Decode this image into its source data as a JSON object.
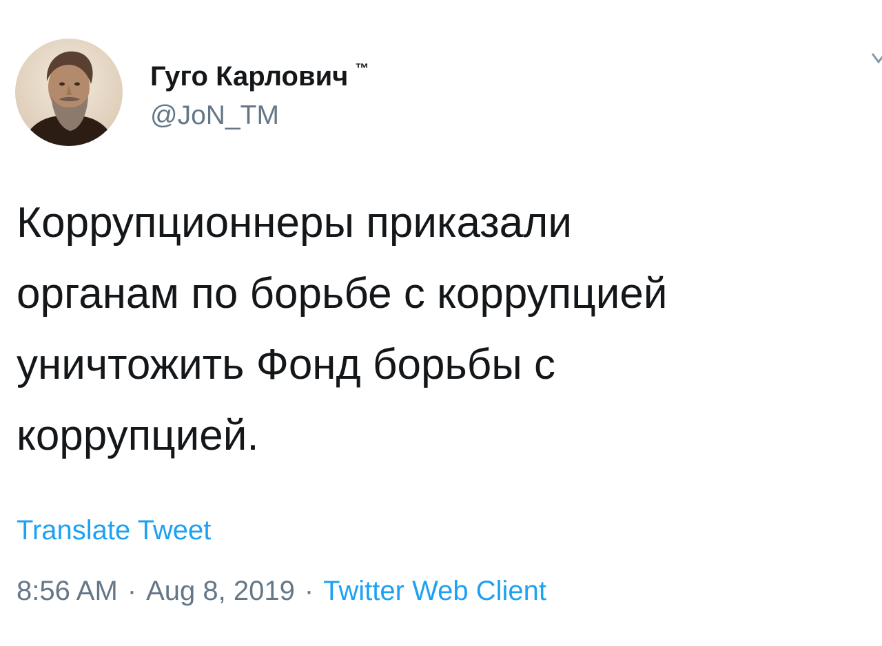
{
  "tweet": {
    "author": {
      "display_name": "Гуго Карлович",
      "tm_mark": "™",
      "handle": "@JoN_TM",
      "avatar_icon": "portrait-avatar"
    },
    "text": "Коррупционнеры приказали\nорганам по борьбе с коррупцией\nуничтожить Фонд борьбы с\nкоррупцией.",
    "translate_label": "Translate Tweet",
    "time": "8:56 AM",
    "separator": "·",
    "date": "Aug 8, 2019",
    "client": "Twitter Web Client",
    "menu_icon": "chevron-down-icon"
  },
  "colors": {
    "text": "#14171a",
    "secondary": "#657786",
    "accent": "#1da1f2"
  }
}
